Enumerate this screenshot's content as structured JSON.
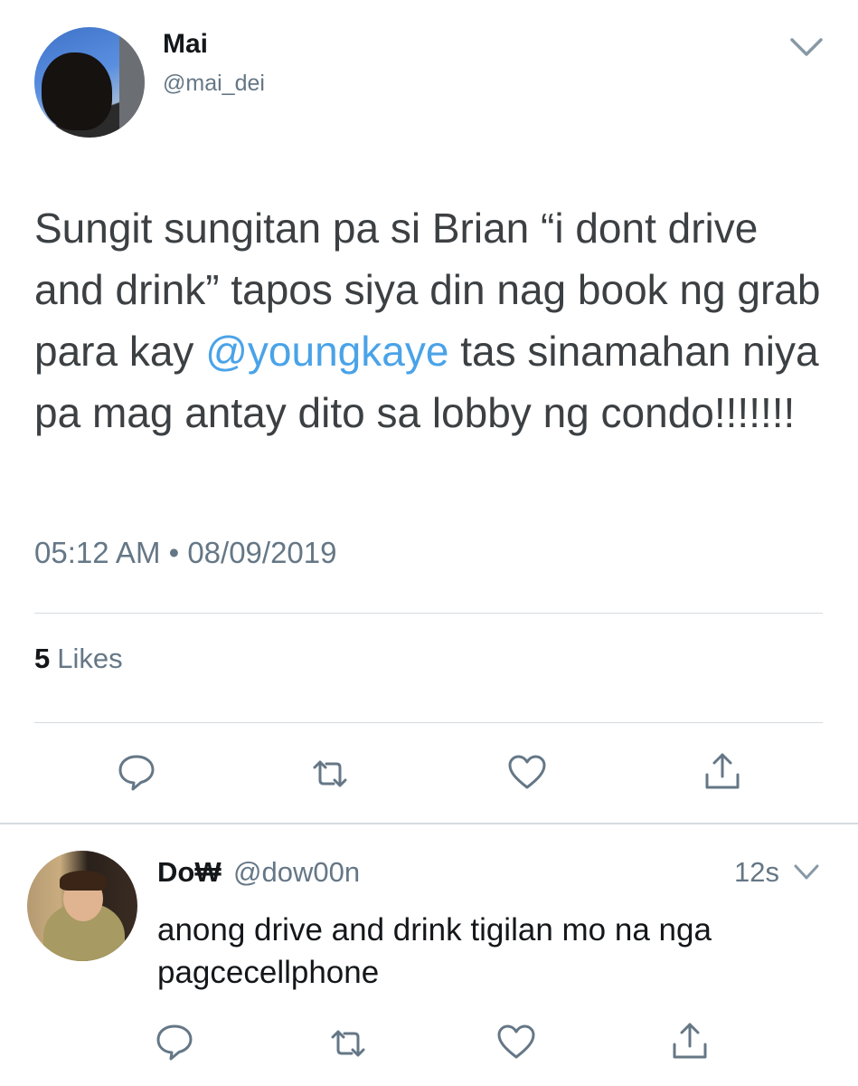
{
  "tweet": {
    "author_name": "Mai",
    "author_handle": "@mai_dei",
    "text_before_mention": "Sungit sungitan pa si Brian “i dont drive and drink” tapos siya din nag book ng grab para kay ",
    "mention": "@youngkaye",
    "text_after_mention": " tas sinamahan niya pa mag antay dito sa lobby ng condo!!!!!!!",
    "timestamp": "05:12 AM • 08/09/2019",
    "likes_count": "5",
    "likes_label": "Likes",
    "icons": [
      "reply-icon",
      "retweet-icon",
      "like-icon",
      "share-icon"
    ]
  },
  "reply": {
    "author_name": "Do₩",
    "author_handle": "@dow00n",
    "time": "12s",
    "text": "anong drive and drink tigilan mo na nga pagcecellphone",
    "icons": [
      "reply-icon",
      "retweet-icon",
      "like-icon",
      "share-icon"
    ]
  },
  "colors": {
    "mention": "#4aa3e8",
    "secondary_text": "#657786",
    "divider": "#d5dbe0",
    "icon": "#657786"
  }
}
